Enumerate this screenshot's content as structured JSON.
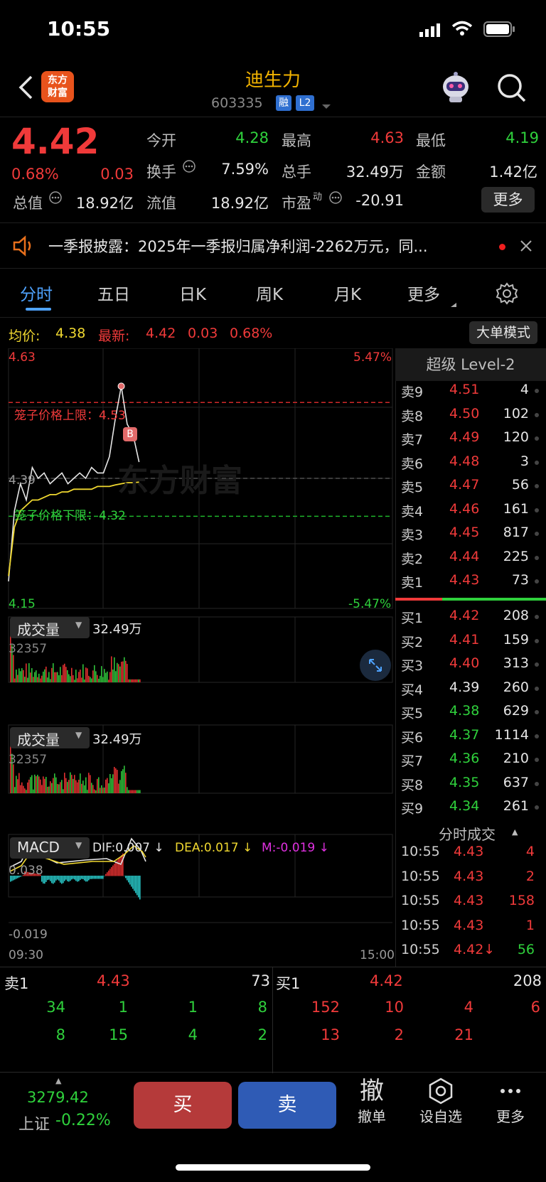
{
  "status_bar": {
    "time": "10:55"
  },
  "header": {
    "logo_text": "东方财富",
    "stock_name": "迪生力",
    "stock_code": "603335",
    "tags": [
      "融",
      "L2"
    ]
  },
  "quote": {
    "price": "4.42",
    "change_pct": "0.68%",
    "change": "0.03",
    "open_label": "今开",
    "open": "4.28",
    "high_label": "最高",
    "high": "4.63",
    "low_label": "最低",
    "low": "4.19",
    "turnover_label": "换手",
    "turnover": "7.59%",
    "volume_label": "总手",
    "volume": "32.49万",
    "amount_label": "金额",
    "amount": "1.42亿",
    "mktcap_label": "总值",
    "mktcap": "18.92亿",
    "float_label": "流值",
    "float": "18.92亿",
    "pe_label": "市盈",
    "pe_sup": "动",
    "pe": "-20.91",
    "more_label": "更多"
  },
  "announcement": {
    "text": "一季报披露：2025年一季报归属净利润-2262万元，同..."
  },
  "tabs": [
    "分时",
    "五日",
    "日K",
    "周K",
    "月K",
    "更多"
  ],
  "chart_header": {
    "avg_label": "均价:",
    "avg": "4.38",
    "latest_label": "最新:",
    "latest": "4.42",
    "latest_change": "0.03",
    "latest_pct": "0.68%",
    "mode_button": "大单模式"
  },
  "chart_labels": {
    "y_top": "4.63",
    "y_bottom": "4.15",
    "pct_top": "5.47%",
    "pct_bottom": "-5.47%",
    "y_mid": "4.39",
    "upper_limit": "笼子价格上限：4.53",
    "lower_limit": "笼子价格下限：4.32",
    "marker": "B",
    "watermark": "东方财富",
    "vol1_label": "成交量",
    "vol1_value": "32.49万",
    "vol1_max": "32357",
    "vol2_label": "成交量",
    "vol2_value": "32.49万",
    "vol2_max": "32357",
    "macd_label": "MACD",
    "dif": "DIF:0.007 ↓",
    "dea": "DEA:0.017 ↓",
    "m": "M:-0.019 ↓",
    "macd_top": "0.038",
    "macd_bottom": "-0.019",
    "time_start": "09:30",
    "time_end": "15:00"
  },
  "chart_data": {
    "type": "line",
    "x_range": [
      "09:30",
      "15:00"
    ],
    "ylim": [
      4.15,
      4.63
    ],
    "series": [
      {
        "values": [
          4.2,
          4.33,
          4.38,
          4.35,
          4.41,
          4.39,
          4.4,
          4.38,
          4.39,
          4.4,
          4.38,
          4.39,
          4.4,
          4.39,
          4.41,
          4.4,
          4.4,
          4.43,
          4.5,
          4.56,
          4.49,
          4.47,
          4.42
        ]
      },
      {
        "values": [
          4.21,
          4.3,
          4.33,
          4.34,
          4.35,
          4.35,
          4.355,
          4.36,
          4.36,
          4.365,
          4.365,
          4.37,
          4.37,
          4.37,
          4.37,
          4.375,
          4.375,
          4.375,
          4.378,
          4.38,
          4.382,
          4.382,
          4.383
        ]
      }
    ]
  },
  "depth": {
    "title": "超级 Level-2",
    "asks": [
      {
        "label": "卖9",
        "price": "4.51",
        "vol": "4"
      },
      {
        "label": "卖8",
        "price": "4.50",
        "vol": "102"
      },
      {
        "label": "卖7",
        "price": "4.49",
        "vol": "120"
      },
      {
        "label": "卖6",
        "price": "4.48",
        "vol": "3"
      },
      {
        "label": "卖5",
        "price": "4.47",
        "vol": "56"
      },
      {
        "label": "卖4",
        "price": "4.46",
        "vol": "161"
      },
      {
        "label": "卖3",
        "price": "4.45",
        "vol": "817"
      },
      {
        "label": "卖2",
        "price": "4.44",
        "vol": "225"
      },
      {
        "label": "卖1",
        "price": "4.43",
        "vol": "73"
      }
    ],
    "bids": [
      {
        "label": "买1",
        "price": "4.42",
        "vol": "208",
        "color": "red"
      },
      {
        "label": "买2",
        "price": "4.41",
        "vol": "159",
        "color": "red"
      },
      {
        "label": "买3",
        "price": "4.40",
        "vol": "313",
        "color": "red"
      },
      {
        "label": "买4",
        "price": "4.39",
        "vol": "260",
        "color": "white"
      },
      {
        "label": "买5",
        "price": "4.38",
        "vol": "629",
        "color": "green"
      },
      {
        "label": "买6",
        "price": "4.37",
        "vol": "1114",
        "color": "green"
      },
      {
        "label": "买7",
        "price": "4.36",
        "vol": "210",
        "color": "green"
      },
      {
        "label": "买8",
        "price": "4.35",
        "vol": "637",
        "color": "green"
      },
      {
        "label": "买9",
        "price": "4.34",
        "vol": "261",
        "color": "green"
      }
    ],
    "ticks_title": "分时成交",
    "ticks": [
      {
        "time": "10:55",
        "price": "4.43",
        "vol": "4",
        "vcolor": "red"
      },
      {
        "time": "10:55",
        "price": "4.43",
        "vol": "2",
        "vcolor": "red"
      },
      {
        "time": "10:55",
        "price": "4.43",
        "vol": "158",
        "vcolor": "red"
      },
      {
        "time": "10:55",
        "price": "4.43",
        "vol": "1",
        "vcolor": "red"
      },
      {
        "time": "10:55",
        "price": "4.42↓",
        "vol": "56",
        "vcolor": "green"
      }
    ]
  },
  "queue": {
    "ask_label": "卖1",
    "ask_price": "4.43",
    "ask_vol": "73",
    "bid_label": "买1",
    "bid_price": "4.42",
    "bid_vol": "208",
    "ask_orders": [
      [
        "34",
        "1",
        "1",
        "8"
      ],
      [
        "8",
        "15",
        "4",
        "2"
      ]
    ],
    "bid_orders": [
      [
        "152",
        "10",
        "4",
        "6"
      ],
      [
        "13",
        "2",
        "21",
        ""
      ]
    ]
  },
  "footer": {
    "index_value": "3279.42",
    "index_name": "上证",
    "index_change": "-0.22%",
    "buy": "买",
    "sell": "卖",
    "cancel_icon": "撤",
    "cancel": "撤单",
    "watch": "设自选",
    "more": "更多"
  },
  "colors": {
    "up": "#f03a3a",
    "down": "#2fd13c",
    "accent": "#f2b300",
    "avg_line": "#f0d830",
    "buy_btn": "#b53a3a",
    "sell_btn": "#2f5bb5"
  }
}
